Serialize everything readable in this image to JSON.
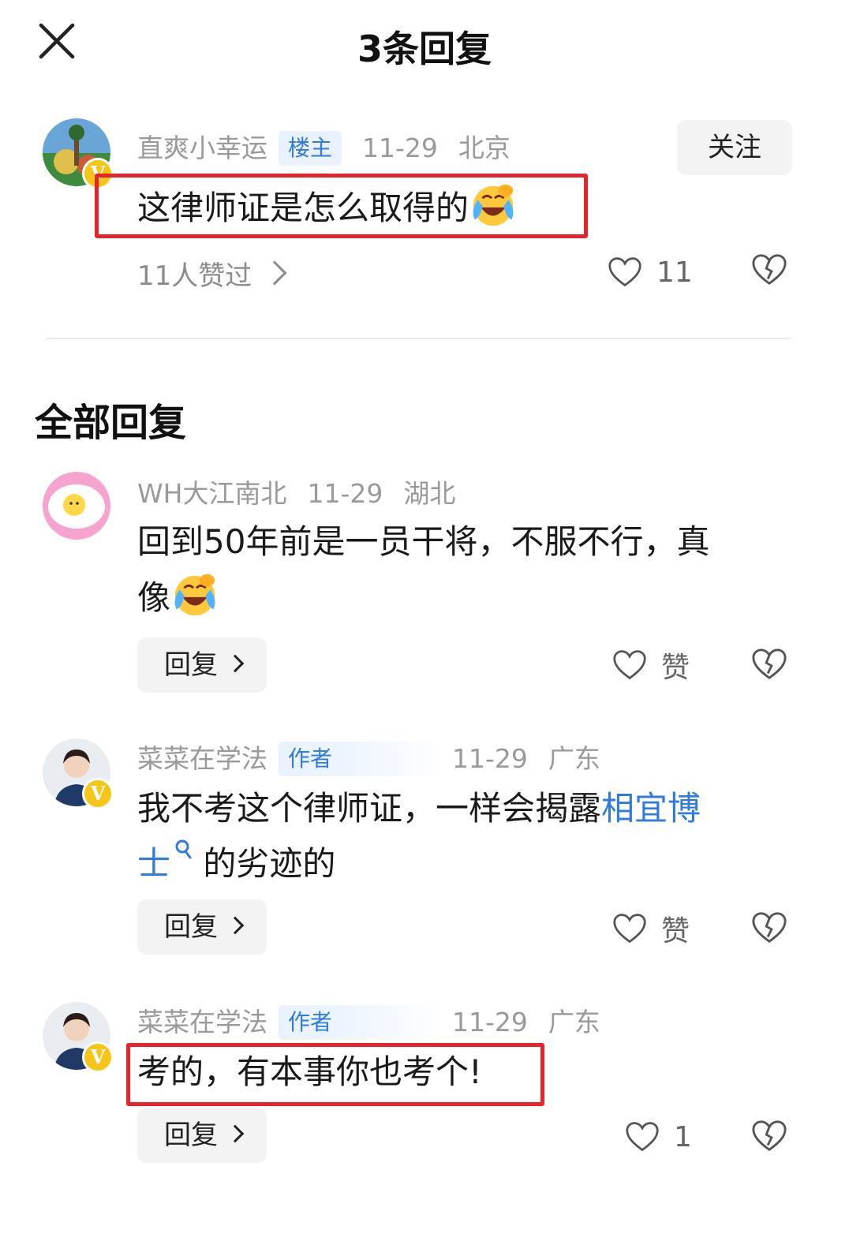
{
  "header": {
    "title": "3条回复"
  },
  "main_comment": {
    "username": "直爽小幸运",
    "tag": "楼主",
    "date": "11-29",
    "location": "北京",
    "follow_label": "关注",
    "text": "这律师证是怎么取得的",
    "likes_text": "11人赞过",
    "like_count": "11",
    "emoji": "laughing-crying-emoji"
  },
  "section": {
    "title": "全部回复"
  },
  "replies": [
    {
      "username": "WH大江南北",
      "date": "11-29",
      "location": "湖北",
      "text": "回到50年前是一员干将，不服不行，真",
      "text2": "像",
      "reply_label": "回复",
      "like_label": "赞"
    },
    {
      "username": "菜菜在学法",
      "tag": "作者",
      "date": "11-29",
      "location": "广东",
      "text_before": "我不考这个律师证，一样会揭露",
      "link_text_1": "相宜博",
      "link_text_2": "士",
      "text_after": " 的劣迹的",
      "reply_label": "回复",
      "like_label": "赞"
    },
    {
      "username": "菜菜在学法",
      "tag": "作者",
      "date": "11-29",
      "location": "广东",
      "text": "考的，有本事你也考个!",
      "reply_label": "回复",
      "like_count": "1"
    }
  ],
  "colors": {
    "highlight_box": "#e5242c",
    "link": "#2f7be0",
    "verified_badge": "#f5c518"
  },
  "badges": {
    "verified": "V"
  }
}
